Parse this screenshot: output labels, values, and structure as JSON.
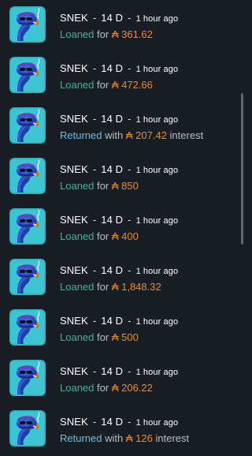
{
  "activity_feed": {
    "items": [
      {
        "token": "SNEK",
        "separator": "-",
        "duration": "14 D",
        "time": "1 hour ago",
        "status": "Loaned",
        "connector": "for",
        "currency_symbol": "₳",
        "amount": "361.62",
        "suffix": ""
      },
      {
        "token": "SNEK",
        "separator": "-",
        "duration": "14 D",
        "time": "1 hour ago",
        "status": "Loaned",
        "connector": "for",
        "currency_symbol": "₳",
        "amount": "472.66",
        "suffix": ""
      },
      {
        "token": "SNEK",
        "separator": "-",
        "duration": "14 D",
        "time": "1 hour ago",
        "status": "Returned",
        "connector": "with",
        "currency_symbol": "₳",
        "amount": "207.42",
        "suffix": "interest"
      },
      {
        "token": "SNEK",
        "separator": "-",
        "duration": "14 D",
        "time": "1 hour ago",
        "status": "Loaned",
        "connector": "for",
        "currency_symbol": "₳",
        "amount": "850",
        "suffix": ""
      },
      {
        "token": "SNEK",
        "separator": "-",
        "duration": "14 D",
        "time": "1 hour ago",
        "status": "Loaned",
        "connector": "for",
        "currency_symbol": "₳",
        "amount": "400",
        "suffix": ""
      },
      {
        "token": "SNEK",
        "separator": "-",
        "duration": "14 D",
        "time": "1 hour ago",
        "status": "Loaned",
        "connector": "for",
        "currency_symbol": "₳",
        "amount": "1,848.32",
        "suffix": ""
      },
      {
        "token": "SNEK",
        "separator": "-",
        "duration": "14 D",
        "time": "1 hour ago",
        "status": "Loaned",
        "connector": "for",
        "currency_symbol": "₳",
        "amount": "500",
        "suffix": ""
      },
      {
        "token": "SNEK",
        "separator": "-",
        "duration": "14 D",
        "time": "1 hour ago",
        "status": "Loaned",
        "connector": "for",
        "currency_symbol": "₳",
        "amount": "206.22",
        "suffix": ""
      },
      {
        "token": "SNEK",
        "separator": "-",
        "duration": "14 D",
        "time": "1 hour ago",
        "status": "Returned",
        "connector": "with",
        "currency_symbol": "₳",
        "amount": "126",
        "suffix": "interest"
      }
    ]
  },
  "colors": {
    "background": "#181e24",
    "loaned": "#37b896",
    "returned": "#5cc6f0",
    "amount": "#f08a2e",
    "avatar_bg": "#3ec3d3"
  },
  "icons": {
    "avatar": "snek-token-avatar-icon"
  }
}
